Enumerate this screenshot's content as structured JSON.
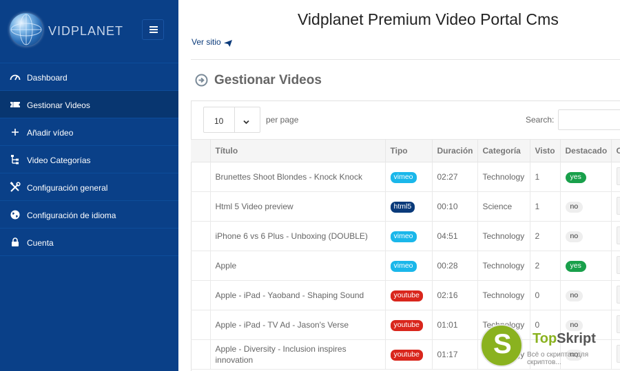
{
  "brand": {
    "name": "VIDPLANET"
  },
  "sidebar": {
    "items": [
      {
        "label": "Dashboard",
        "icon": "speedometer-icon"
      },
      {
        "label": "Gestionar Videos",
        "icon": "ticket-icon"
      },
      {
        "label": "Añadir vídeo",
        "icon": "plus-icon"
      },
      {
        "label": "Video Categorías",
        "icon": "sitemap-icon"
      },
      {
        "label": "Configuración general",
        "icon": "tools-icon"
      },
      {
        "label": "Configuración de idioma",
        "icon": "globe-icon"
      },
      {
        "label": "Cuenta",
        "icon": "lock-icon"
      }
    ],
    "active_index": 1
  },
  "header": {
    "title": "Vidplanet Premium Video Portal Cms",
    "site_link": "Ver sitio"
  },
  "section": {
    "title": "Gestionar Videos"
  },
  "controls": {
    "page_size": "10",
    "per_page_label": "per page",
    "search_label": "Search:"
  },
  "table": {
    "headers": [
      "Título",
      "Tipo",
      "Duración",
      "Categoría",
      "Visto",
      "Destacado",
      "O"
    ],
    "rows": [
      {
        "title": "Brunettes Shoot Blondes - Knock Knock",
        "type": "vimeo",
        "duration": "02:27",
        "category": "Technology",
        "views": "1",
        "featured": "yes"
      },
      {
        "title": "Html 5 Video preview",
        "type": "html5",
        "duration": "00:10",
        "category": "Science",
        "views": "1",
        "featured": "no"
      },
      {
        "title": "iPhone 6 vs 6 Plus - Unboxing (DOUBLE)",
        "type": "vimeo",
        "duration": "04:51",
        "category": "Technology",
        "views": "2",
        "featured": "no"
      },
      {
        "title": "Apple",
        "type": "vimeo",
        "duration": "00:28",
        "category": "Technology",
        "views": "2",
        "featured": "yes"
      },
      {
        "title": "Apple - iPad - Yaoband - Shaping Sound",
        "type": "youtube",
        "duration": "02:16",
        "category": "Technology",
        "views": "0",
        "featured": "no"
      },
      {
        "title": "Apple - iPad - TV Ad - Jason's Verse",
        "type": "youtube",
        "duration": "01:01",
        "category": "Technology",
        "views": "0",
        "featured": "no"
      },
      {
        "title": "Apple - Diversity - Inclusion inspires innovation",
        "type": "youtube",
        "duration": "01:17",
        "category": "Technology",
        "views": "",
        "featured": "no"
      }
    ]
  },
  "type_colors": {
    "vimeo": "#1ab7ea",
    "html5": "#0a3a7a",
    "youtube": "#d9261c"
  },
  "watermark": {
    "letter": "S",
    "name_a": "Top",
    "name_b": "Skript",
    "tagline": "Всё о скриптах для скриптов..."
  }
}
